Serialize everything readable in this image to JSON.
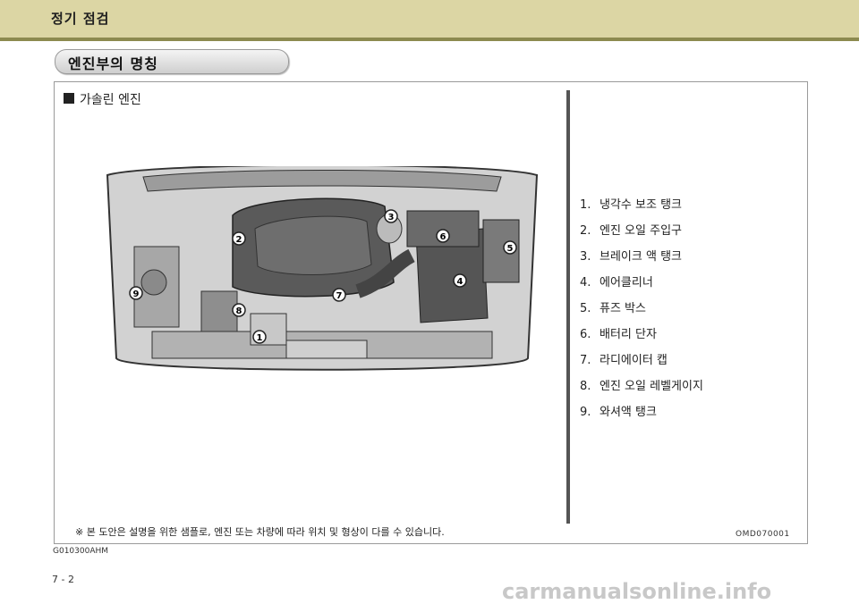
{
  "header": {
    "title": "정기 점검"
  },
  "section": {
    "title": "엔진부의 명칭"
  },
  "subtitle": "가솔린 엔진",
  "callouts": [
    "1",
    "2",
    "3",
    "4",
    "5",
    "6",
    "7",
    "8",
    "9"
  ],
  "legend": [
    {
      "num": "1.",
      "label": "냉각수 보조 탱크"
    },
    {
      "num": "2.",
      "label": "엔진 오일 주입구"
    },
    {
      "num": "3.",
      "label": "브레이크 액 탱크"
    },
    {
      "num": "4.",
      "label": "에어클리너"
    },
    {
      "num": "5.",
      "label": "퓨즈 박스"
    },
    {
      "num": "6.",
      "label": "배터리 단자"
    },
    {
      "num": "7.",
      "label": "라디에이터 캡"
    },
    {
      "num": "8.",
      "label": "엔진 오일 레벨게이지"
    },
    {
      "num": "9.",
      "label": "와셔액 탱크"
    }
  ],
  "note": "※  본 도안은 설명을 위한 샘플로, 엔진 또는 차량에 따라 위치 및 형상이 다를 수 있습니다.",
  "figure_code": "OMD070001",
  "doc_code": "G010300AHM",
  "page_number": "7 - 2",
  "watermark": "carmanualsonline.info"
}
